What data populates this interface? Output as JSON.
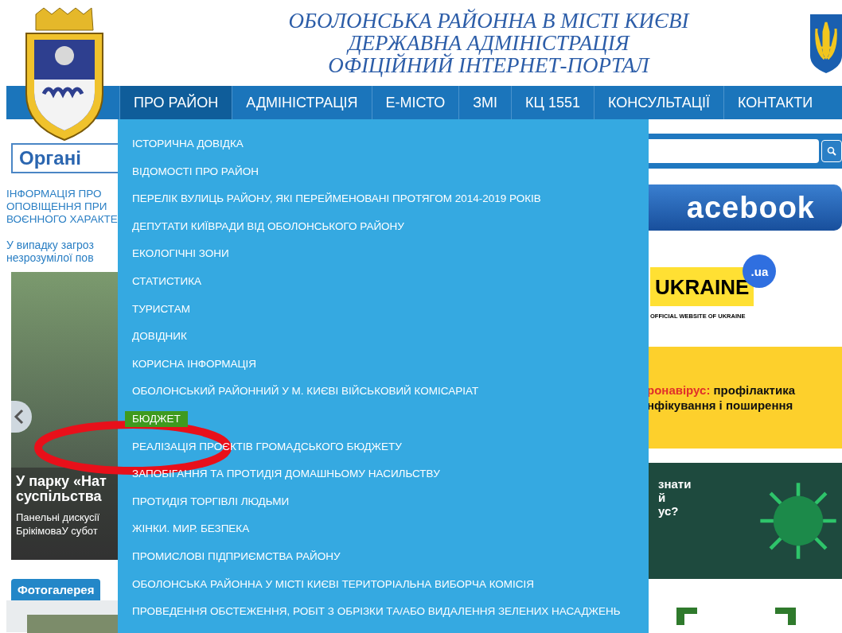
{
  "header": {
    "title_lines": [
      "ОБОЛОНСЬКА РАЙОННА В МІСТІ КИЄВІ",
      "ДЕРЖАВНА АДМІНІСТРАЦІЯ",
      "ОФІЦІЙНИЙ ІНТЕРНЕТ-ПОРТАЛ"
    ]
  },
  "nav": [
    {
      "label": "ПРО РАЙОН",
      "selected": true
    },
    {
      "label": "АДМІНІСТРАЦІЯ",
      "selected": false
    },
    {
      "label": "Е-МІСТО",
      "selected": false
    },
    {
      "label": "ЗМІ",
      "selected": false
    },
    {
      "label": "КЦ 1551",
      "selected": false
    },
    {
      "label": "КОНСУЛЬТАЦІЇ",
      "selected": false
    },
    {
      "label": "КОНТАКТИ",
      "selected": false
    }
  ],
  "dropdown": {
    "items": [
      {
        "label": "ІСТОРИЧНА ДОВІДКА",
        "selected": false
      },
      {
        "label": "ВІДОМОСТІ ПРО РАЙОН",
        "selected": false
      },
      {
        "label": "ПЕРЕЛІК ВУЛИЦЬ РАЙОНУ, ЯКІ ПЕРЕЙМЕНОВАНІ ПРОТЯГОМ 2014-2019 РОКІВ",
        "selected": false
      },
      {
        "label": "ДЕПУТАТИ КИЇВРАДИ ВІД ОБОЛОНСЬКОГО РАЙОНУ",
        "selected": false
      },
      {
        "label": "ЕКОЛОГІЧНІ ЗОНИ",
        "selected": false
      },
      {
        "label": "СТАТИСТИКА",
        "selected": false
      },
      {
        "label": "ТУРИСТАМ",
        "selected": false
      },
      {
        "label": "ДОВІДНИК",
        "selected": false
      },
      {
        "label": "КОРИСНА ІНФОРМАЦІЯ",
        "selected": false
      },
      {
        "label": "ОБОЛОНСЬКИЙ РАЙОННИЙ У М. КИЄВІ ВІЙСЬКОВИЙ КОМІСАРІАТ",
        "selected": false
      },
      {
        "label": "БЮДЖЕТ",
        "selected": true
      },
      {
        "label": "РЕАЛІЗАЦІЯ ПРОЄКТІВ ГРОМАДСЬКОГО БЮДЖЕТУ",
        "selected": false
      },
      {
        "label": "ЗАПОБІГАННЯ ТА ПРОТИДІЯ ДОМАШНЬОМУ НАСИЛЬСТВУ",
        "selected": false
      },
      {
        "label": "ПРОТИДІЯ ТОРГІВЛІ ЛЮДЬМИ",
        "selected": false
      },
      {
        "label": "ЖІНКИ. МИР. БЕЗПЕКА",
        "selected": false
      },
      {
        "label": "ПРОМИСЛОВІ ПІДПРИЄМСТВА РАЙОНУ",
        "selected": false
      },
      {
        "label": "ОБОЛОНСЬКА РАЙОННА У МІСТІ КИЄВІ ТЕРИТОРІАЛЬНА ВИБОРЧА КОМІСІЯ",
        "selected": false
      },
      {
        "label": "ПРОВЕДЕННЯ ОБСТЕЖЕННЯ, РОБІТ З ОБРІЗКИ ТА/АБО ВИДАЛЕННЯ ЗЕЛЕНИХ НАСАДЖЕНЬ",
        "selected": false
      }
    ]
  },
  "content": {
    "banner_text": "Органі",
    "info_lines": [
      "ІНФОРМАЦІЯ ПРО",
      "ОПОВІЩЕННЯ ПРИ",
      "ВОЄННОГО ХАРАКТЕ"
    ],
    "notice_lines": [
      "У випадку загроз",
      "незрозумілої пов"
    ],
    "slide": {
      "title_lines": [
        "У парку «Нат",
        "суспільства"
      ],
      "text_lines": [
        "Панельні дискусії",
        "БрікімоваУ субот"
      ]
    },
    "tabs": [
      {
        "label": "Фотогалерея",
        "selected": true
      }
    ]
  },
  "sidebar": {
    "facebook_text": "acebook",
    "ukraine": {
      "badge": ".ua",
      "name": "UKRAINE",
      "caption": "OFFICIAL WEBSITE OF UKRAINE"
    },
    "covid_banner": {
      "accent": "ронавірус:",
      "line_1": "профілактика",
      "line_2": "нфікування і поширення"
    },
    "virus_banner": {
      "lines": [
        "знати",
        "й",
        "ус?"
      ]
    }
  }
}
